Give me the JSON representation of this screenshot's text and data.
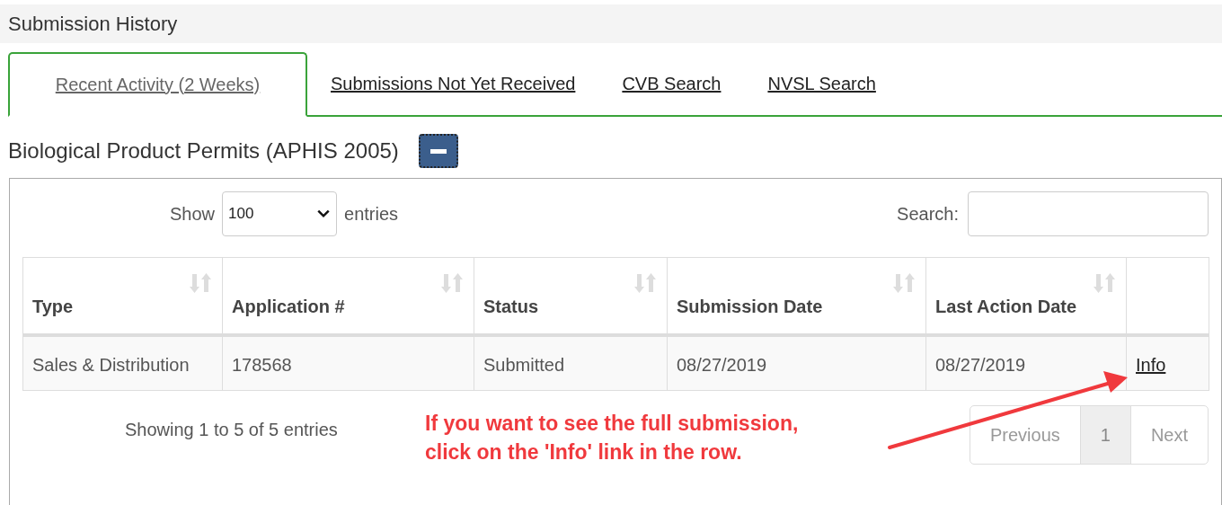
{
  "page_header": {
    "title": "Submission History"
  },
  "tabs": [
    {
      "label": "Recent Activity (2 Weeks)",
      "selected": true
    },
    {
      "label": "Submissions Not Yet Received",
      "selected": false
    },
    {
      "label": "CVB Search",
      "selected": false
    },
    {
      "label": "NVSL Search",
      "selected": false
    }
  ],
  "section": {
    "title": "Biological Product Permits (APHIS 2005)",
    "expanded": true
  },
  "length_control": {
    "label_before": "Show",
    "value": "100",
    "label_after": "entries"
  },
  "search": {
    "label": "Search:"
  },
  "table": {
    "columns": [
      {
        "label": "Type",
        "sortable": true
      },
      {
        "label": "Application #",
        "sortable": true
      },
      {
        "label": "Status",
        "sortable": true
      },
      {
        "label": "Submission Date",
        "sortable": true
      },
      {
        "label": "Last Action Date",
        "sortable": true
      },
      {
        "sortable": false
      }
    ],
    "rows": [
      {
        "cells": [
          "Sales & Distribution",
          "178568",
          "Submitted",
          "08/27/2019",
          "08/27/2019"
        ],
        "link": "Info"
      }
    ]
  },
  "info_text": "Showing 1 to 5 of 5 entries",
  "annotation": {
    "lines": [
      "If you want to see the full submission,",
      "click on the 'Info' link in the row."
    ]
  },
  "pagination": [
    {
      "label": "Previous",
      "kind": "nav",
      "disabled": true,
      "selected": false
    },
    {
      "label": "1",
      "kind": "page",
      "disabled": false,
      "selected": true
    },
    {
      "label": "Next",
      "kind": "nav",
      "disabled": true,
      "selected": false
    }
  ]
}
